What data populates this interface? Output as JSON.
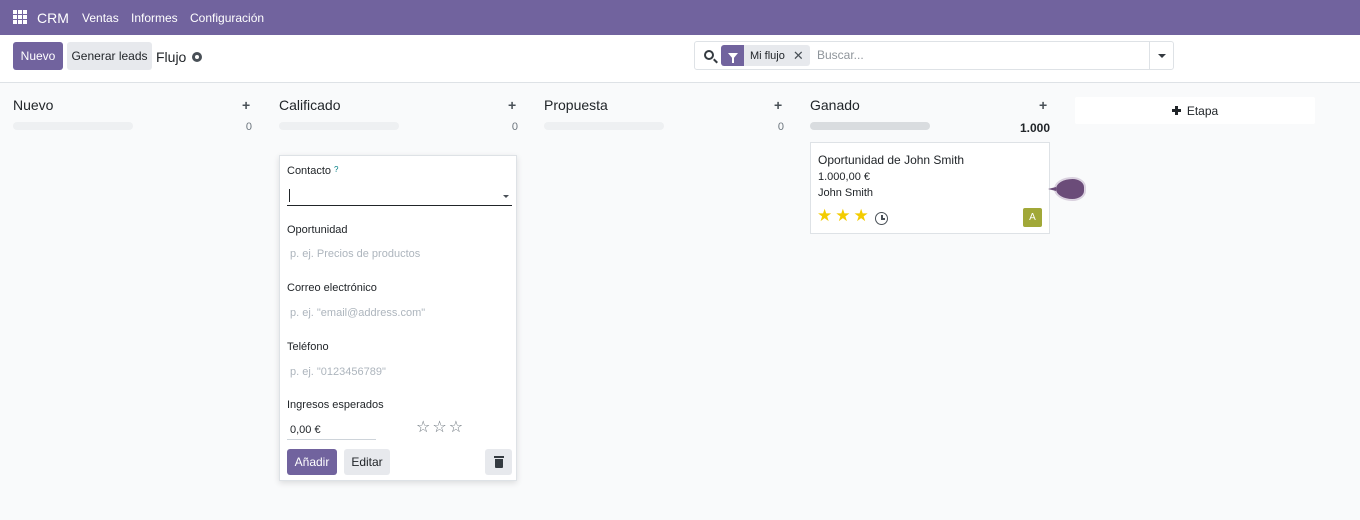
{
  "navbar": {
    "app_name": "CRM",
    "menu": [
      "Ventas",
      "Informes",
      "Configuración"
    ]
  },
  "control_panel": {
    "new_label": "Nuevo",
    "generate_leads_label": "Generar leads",
    "breadcrumb": "Flujo",
    "search": {
      "facet_label": "Mi flujo",
      "facet_remove": "✕",
      "placeholder": "Buscar..."
    }
  },
  "kanban": {
    "columns": [
      {
        "title": "Nuevo",
        "count": "0",
        "add": "+"
      },
      {
        "title": "Calificado",
        "count": "0",
        "add": "+"
      },
      {
        "title": "Propuesta",
        "count": "0",
        "add": "+"
      },
      {
        "title": "Ganado",
        "count": "1.000",
        "add": "+"
      }
    ],
    "add_stage_label": "Etapa"
  },
  "quick_create": {
    "contact_label": "Contacto",
    "contact_help": "?",
    "opportunity_label": "Oportunidad",
    "opportunity_placeholder": "p. ej. Precios de productos",
    "email_label": "Correo electrónico",
    "email_placeholder": "p. ej. \"email@address.com\"",
    "phone_label": "Teléfono",
    "phone_placeholder": "p. ej. \"0123456789\"",
    "revenue_label": "Ingresos esperados",
    "revenue_value": "0,00 €",
    "priority_stars": [
      "☆",
      "☆",
      "☆"
    ],
    "add_label": "Añadir",
    "edit_label": "Editar"
  },
  "card": {
    "title": "Oportunidad de John Smith",
    "amount": "1.000,00 €",
    "contact": "John Smith",
    "priority_stars": [
      "★",
      "★",
      "★"
    ],
    "avatar_letter": "A"
  },
  "colors": {
    "brand": "#71639e",
    "star": "#f3cc00",
    "avatar": "#a1a838"
  }
}
